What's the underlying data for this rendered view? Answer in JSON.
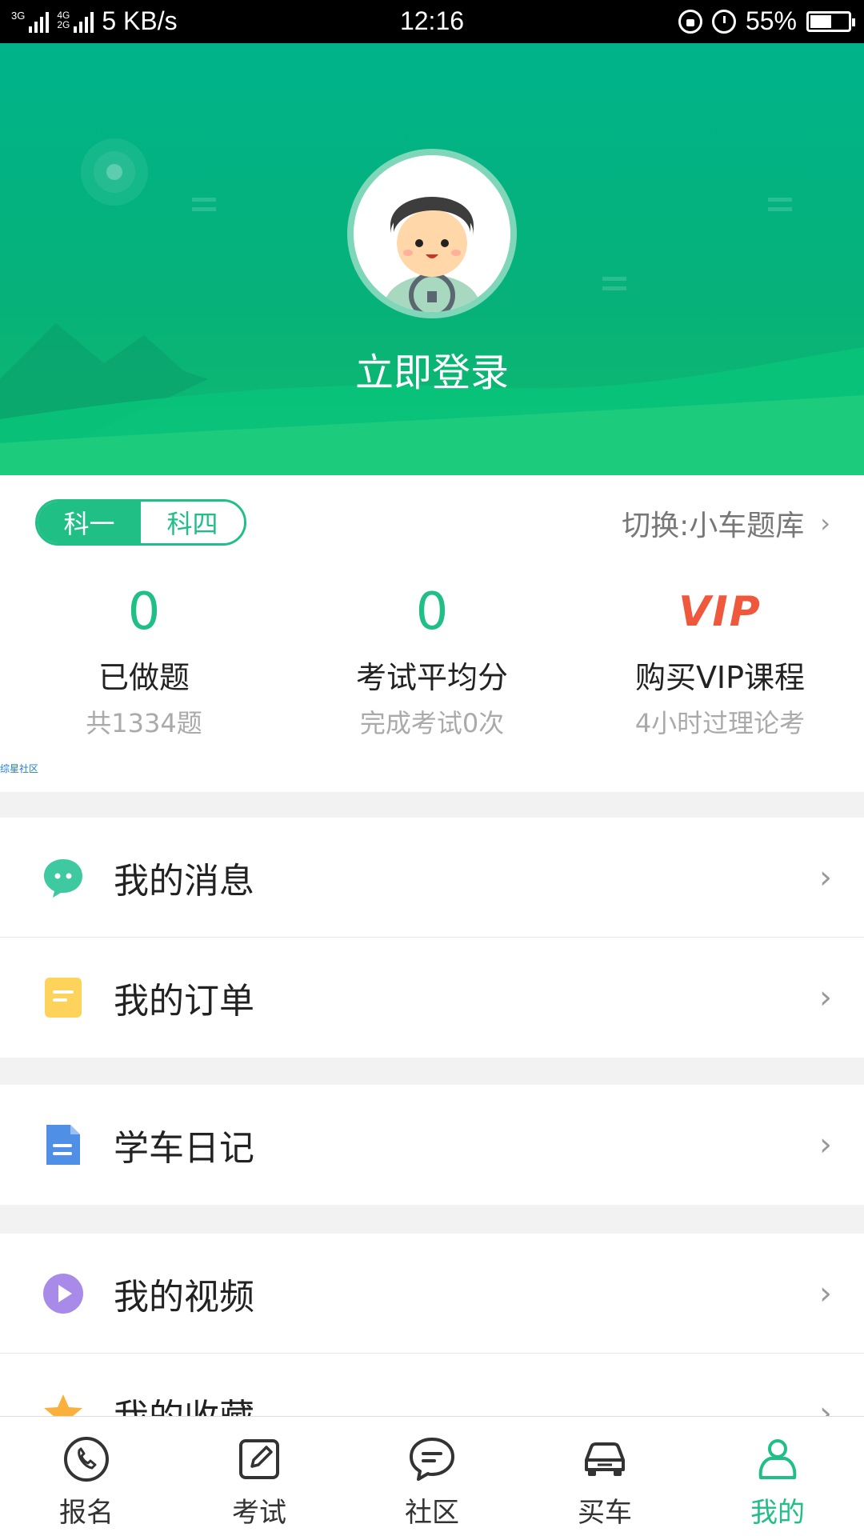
{
  "status_bar": {
    "network_label_1": "3G",
    "network_label_2": "4G",
    "network_label_3": "2G",
    "speed": "5 KB/s",
    "time": "12:16",
    "battery": "55%"
  },
  "header": {
    "login_label": "立即登录",
    "accent_color": "#00b38a"
  },
  "subject_toggle": {
    "options": [
      "科一",
      "科四"
    ],
    "selected": "科一"
  },
  "switch_bank": "切换:小车题库",
  "stats": [
    {
      "value": "0",
      "label": "已做题",
      "sub": "共1334题"
    },
    {
      "value": "0",
      "label": "考试平均分",
      "sub": "完成考试0次"
    },
    {
      "value": "VIP",
      "label": "购买VIP课程",
      "sub": "4小时过理论考"
    }
  ],
  "watermark": "综星社区",
  "menu": [
    {
      "label": "我的消息",
      "icon": "chat-bubble-icon"
    },
    {
      "label": "我的订单",
      "icon": "order-note-icon"
    },
    {
      "label": "学车日记",
      "icon": "document-icon"
    },
    {
      "label": "我的视频",
      "icon": "play-icon"
    },
    {
      "label": "我的收藏",
      "icon": "star-icon"
    }
  ],
  "bottom_nav": [
    {
      "label": "报名",
      "icon": "phone-icon"
    },
    {
      "label": "考试",
      "icon": "edit-icon"
    },
    {
      "label": "社区",
      "icon": "community-chat-icon"
    },
    {
      "label": "买车",
      "icon": "car-icon"
    },
    {
      "label": "我的",
      "icon": "profile-icon",
      "active": true
    }
  ]
}
